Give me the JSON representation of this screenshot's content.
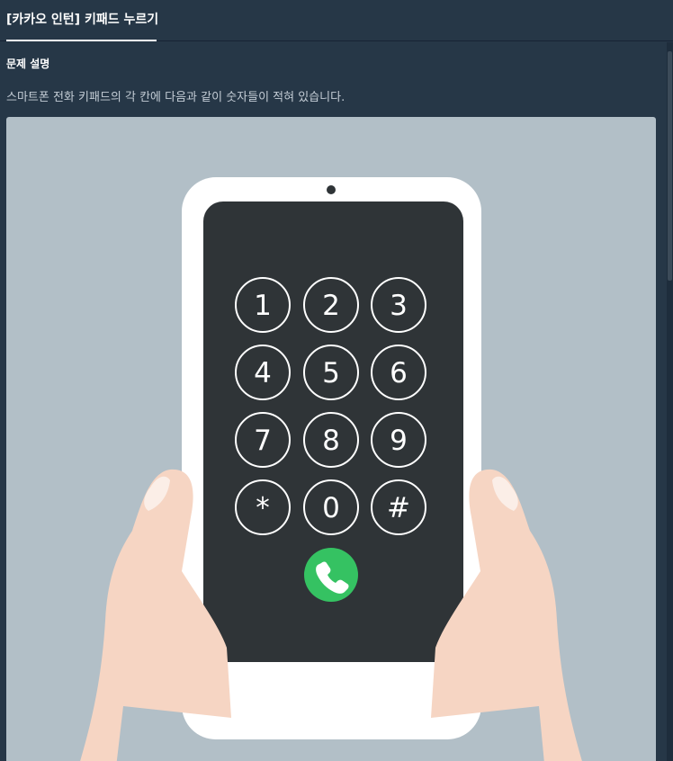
{
  "tabs": [
    {
      "label": "[카카오 인턴] 키패드 누르기",
      "active": true
    }
  ],
  "problem": {
    "section_title": "문제 설명",
    "description": "스마트폰 전화 키패드의 각 칸에 다음과 같이 숫자들이 적혀 있습니다."
  },
  "keypad": {
    "keys": [
      "1",
      "2",
      "3",
      "4",
      "5",
      "6",
      "7",
      "8",
      "9",
      "*",
      "0",
      "#"
    ],
    "call_icon": "phone-icon"
  },
  "colors": {
    "background": "#263747",
    "illustration_bg": "#b2bfc7",
    "screen": "#2f3437",
    "call_button": "#35c262",
    "skin": "#f6d5c3"
  }
}
